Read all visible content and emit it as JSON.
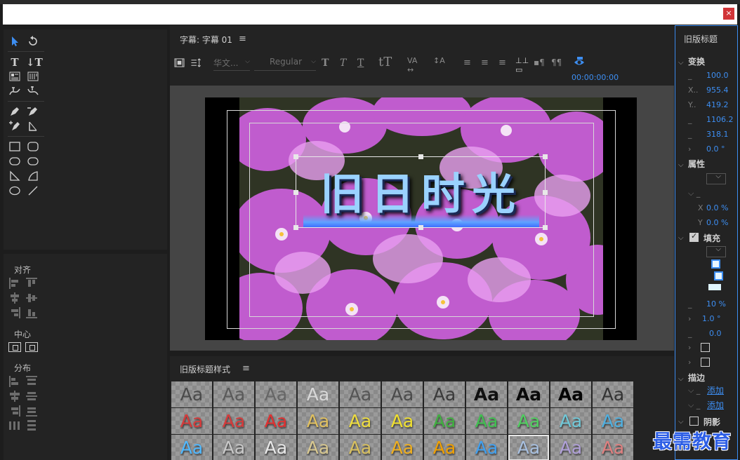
{
  "window": {
    "close_label": "×"
  },
  "editor": {
    "title": "字幕: 字幕 01",
    "menu": "≡",
    "font_family": "华文...",
    "font_style": "Regular",
    "timecode": "00:00:00:00",
    "title_text": "旧日时光"
  },
  "align_panel": {
    "align_label": "对齐",
    "center_label": "中心",
    "distribute_label": "分布"
  },
  "styles_panel": {
    "title": "旧版标题样式",
    "menu": "≡",
    "sample": "Aa",
    "rows": [
      [
        "#4a4a4a",
        "#5a5a5a",
        "#666666",
        "#d8d8d8",
        "#555555",
        "#4a4a4a",
        "#3a3a3a",
        "#111111",
        "#0a0a0a",
        "#050505",
        "#333333"
      ],
      [
        "#d63a3a",
        "#d63a3a",
        "#e23030",
        "#e0c060",
        "#eedd40",
        "#f0e030",
        "#40b040",
        "#40c050",
        "#50d060",
        "#70c8d8",
        "#50b0e0"
      ],
      [
        "#50b8ff",
        "#c8c8c8",
        "#e8e8e8",
        "#d8c890",
        "#d8c060",
        "#f0b020",
        "#f0a000",
        "#40a0f0",
        "#a8c0e0",
        "#b0a0d8",
        "#e08080"
      ]
    ]
  },
  "properties": {
    "title": "旧版标题",
    "transform_label": "变换",
    "opacity": "100.0",
    "x_pos": "955.4",
    "y_pos": "419.2",
    "width": "1106.2",
    "height": "318.1",
    "rotation": "0.0 °",
    "attributes_label": "属性",
    "dist_x_label": "X",
    "dist_x": "0.0 %",
    "dist_y_label": "Y",
    "dist_y": "0.0 %",
    "fill_label": "填充",
    "fill_pct": "10 %",
    "fill_angle": "1.0 °",
    "fill_val": "0.0",
    "stroke_label": "描边",
    "add_label": "添加",
    "add_label2": "添加",
    "shadow_label": "阴影",
    "dash": "_"
  },
  "watermark": "最需教育"
}
